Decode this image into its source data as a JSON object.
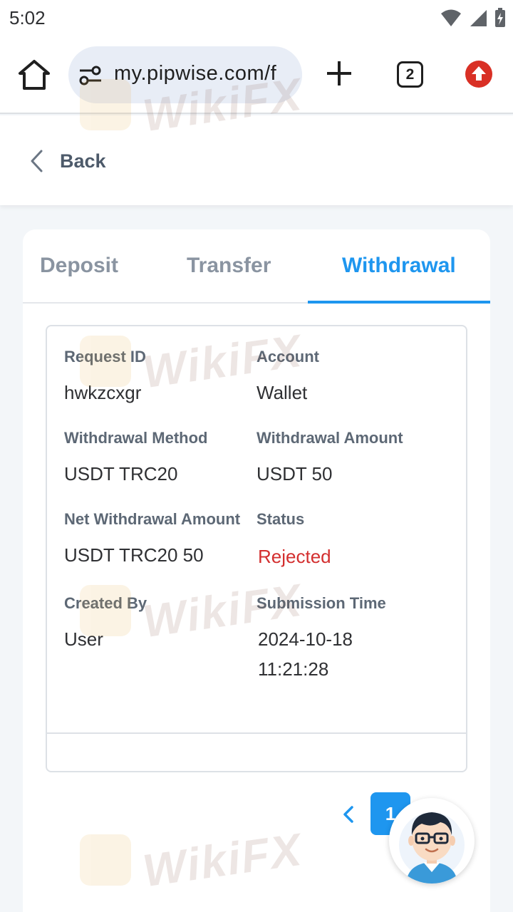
{
  "status_bar": {
    "time": "5:02"
  },
  "browser": {
    "url": "my.pipwise.com/f",
    "tab_count": "2"
  },
  "header": {
    "back_label": "Back"
  },
  "tabs": [
    {
      "label": "Deposit",
      "active": false
    },
    {
      "label": "Transfer",
      "active": false
    },
    {
      "label": "Withdrawal",
      "active": true
    }
  ],
  "record": {
    "request_id_label": "Request ID",
    "request_id": "hwkzcxgr",
    "account_label": "Account",
    "account": "Wallet",
    "method_label": "Withdrawal Method",
    "method": "USDT TRC20",
    "amount_label": "Withdrawal Amount",
    "amount": "USDT 50",
    "net_amount_label": "Net Withdrawal Amount",
    "net_amount": "USDT TRC20 50",
    "status_label": "Status",
    "status": "Rejected",
    "created_by_label": "Created By",
    "created_by": "User",
    "submission_time_label": "Submission Time",
    "submission_time": "2024-10-18 11:21:28"
  },
  "pagination": {
    "current_page": "1"
  },
  "watermark": {
    "text": "WikiFX"
  },
  "colors": {
    "accent": "#1e96ef",
    "rejected": "#d32f2f",
    "update_badge": "#d93025"
  }
}
